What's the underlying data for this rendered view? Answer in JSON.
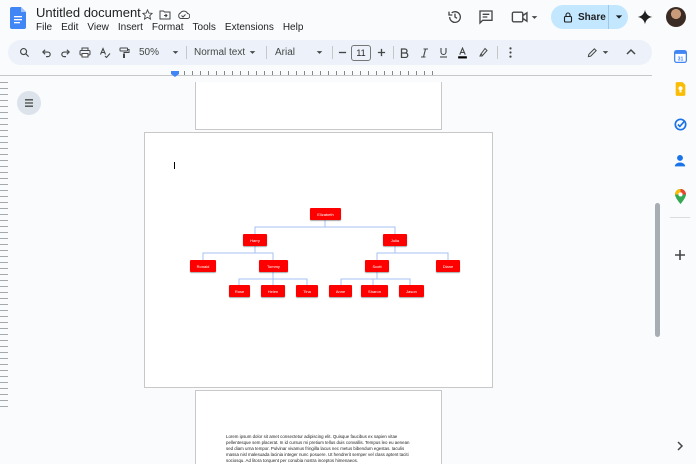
{
  "document": {
    "title": "Untitled document"
  },
  "menu": [
    "File",
    "Edit",
    "View",
    "Insert",
    "Format",
    "Tools",
    "Extensions",
    "Help"
  ],
  "header": {
    "share_label": "Share"
  },
  "toolbar": {
    "zoom": "50%",
    "style": "Normal text",
    "font": "Arial",
    "font_size": "11"
  },
  "org_chart": {
    "root": "Elizabeth",
    "level1": [
      "Harry",
      "Julia"
    ],
    "level2": [
      "Ronald",
      "Tommy",
      "Scott",
      "Diane"
    ],
    "level3": [
      "Rose",
      "Helen",
      "Tina",
      "Anne",
      "Sharon",
      "Jason"
    ],
    "node_color": "#ff0000",
    "connector_color": "#a4c2f4"
  },
  "lorem_text": "Lorem ipsum dolor sit amet consectetur adipiscing elit. Quisque faucibus ex sapien vitae pellentesque sem placerat. In id cursus mi pretium tellus duis convallis. Tempus leo eu aenean sed diam urna tempor. Pulvinar vivamus fringilla lacus nec metus bibendum egestas. Iaculis massa nisl malesuada lacinia integer nunc posuere. Ut hendrerit semper vel class aptent taciti sociosqu. Ad litora torquent per conubia nostra inceptos himenaeos.",
  "colors": {
    "brand_blue": "#4285f4",
    "share_bg": "#c2e7ff",
    "toolbar_bg": "#edf2fa"
  }
}
